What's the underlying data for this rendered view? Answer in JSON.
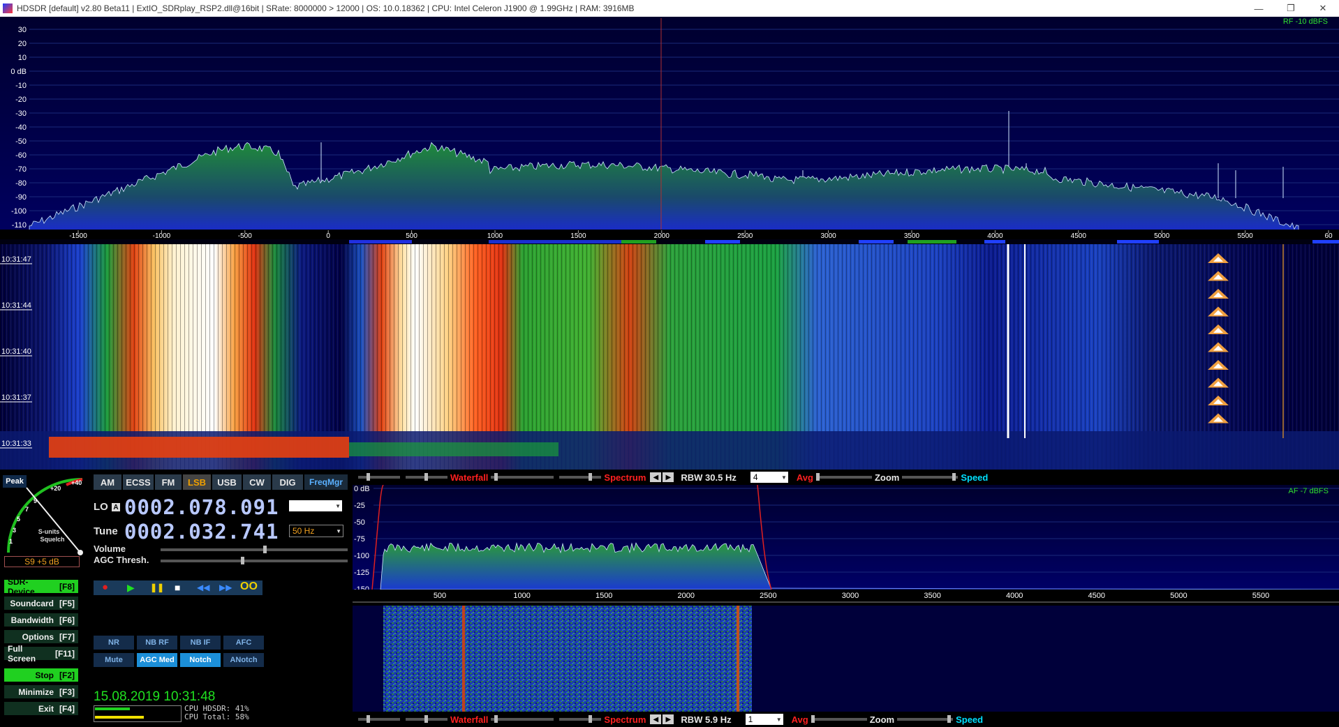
{
  "window": {
    "title": "HDSDR  [default]  v2.80 Beta11  |  ExtIO_SDRplay_RSP2.dll@16bit  |  SRate: 8000000 > 12000  |  OS: 10.0.18362  |  CPU: Intel Celeron  J1900  @ 1.99GHz  |  RAM: 3916MB",
    "minimize": "—",
    "restore": "❐",
    "close": "✕"
  },
  "rf_spectrum": {
    "level_label": "RF -10 dBFS",
    "db_ticks": [
      "30",
      "20",
      "10",
      "0 dB",
      "-10",
      "-20",
      "-30",
      "-40",
      "-50",
      "-60",
      "-70",
      "-80",
      "-90",
      "-100",
      "-110"
    ],
    "freq_ticks": [
      "-1500",
      "-1000",
      "-500",
      "0",
      "500",
      "1000",
      "1500",
      "2000",
      "2500",
      "3000",
      "3500",
      "4000",
      "4500",
      "5000",
      "5500",
      "60"
    ]
  },
  "waterfall": {
    "timestamps": [
      "10:31:47",
      "10:31:44",
      "10:31:40",
      "10:31:37",
      "10:31:33"
    ]
  },
  "rf_controls": {
    "waterfall": "Waterfall",
    "spectrum": "Spectrum",
    "rbw": "RBW 30.5 Hz",
    "avg_value": "4",
    "avg": "Avg",
    "zoom": "Zoom",
    "speed": "Speed"
  },
  "meter": {
    "peak": "Peak",
    "scale": [
      "1",
      "3",
      "5",
      "7",
      "9",
      "+20",
      "+40"
    ],
    "caption1": "S-units",
    "caption2": "Squelch",
    "reading": "S9 +5 dB"
  },
  "modes": [
    "AM",
    "ECSS",
    "FM",
    "LSB",
    "USB",
    "CW",
    "DIG",
    "FreqMgr"
  ],
  "active_mode": "LSB",
  "lo": {
    "label": "LO",
    "badge": "A",
    "value": "0002.078.091"
  },
  "tune": {
    "label": "Tune",
    "value": "0002.032.741",
    "step": "50 Hz"
  },
  "sliders": {
    "volume": "Volume",
    "agc": "AGC Thresh."
  },
  "transport": {
    "rec": "●",
    "play": "▶",
    "pause": "❚❚",
    "stop": "■",
    "rew": "◀◀",
    "ffw": "▶▶",
    "loop": "OO"
  },
  "side_buttons": [
    {
      "label": "SDR-Device",
      "key": "[F8]"
    },
    {
      "label": "Soundcard",
      "key": "[F5]"
    },
    {
      "label": "Bandwidth",
      "key": "[F6]"
    },
    {
      "label": "Options",
      "key": "[F7]"
    },
    {
      "label": "Full Screen",
      "key": "[F11]"
    },
    {
      "label": "Stop",
      "key": "[F2]"
    },
    {
      "label": "Minimize",
      "key": "[F3]"
    },
    {
      "label": "Exit",
      "key": "[F4]"
    }
  ],
  "dsp_buttons": [
    "NR",
    "NB RF",
    "NB IF",
    "AFC",
    "Mute",
    "AGC Med",
    "Notch",
    "ANotch"
  ],
  "status": {
    "datetime": "15.08.2019 10:31:48",
    "cpu_hdsdr": "CPU HDSDR: 41%",
    "cpu_total": "CPU Total: 58%"
  },
  "af_spectrum": {
    "level_label": "AF -7 dBFS",
    "db_ticks": [
      "0 dB",
      "-25",
      "-50",
      "-75",
      "-100",
      "-125",
      "-150"
    ],
    "freq_ticks": [
      "500",
      "1000",
      "1500",
      "2000",
      "2500",
      "3000",
      "3500",
      "4000",
      "4500",
      "5000",
      "5500"
    ]
  },
  "af_controls": {
    "waterfall": "Waterfall",
    "spectrum": "Spectrum",
    "rbw": "RBW  5.9 Hz",
    "avg_value": "1",
    "avg": "Avg",
    "zoom": "Zoom",
    "speed": "Speed"
  },
  "colors": {
    "accent_green": "#20e020",
    "spectrum_bg": "#00003a",
    "waterfall_red": "#ff2020",
    "speed_cyan": "#00e0ff",
    "digits": "#b8c8ff"
  }
}
